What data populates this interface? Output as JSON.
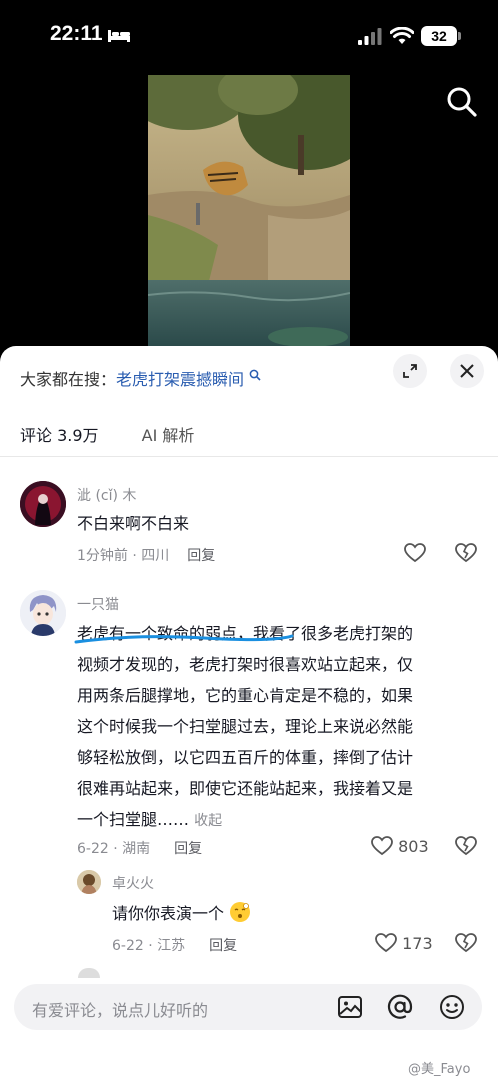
{
  "status_bar": {
    "time": "22:11",
    "battery": "32"
  },
  "hot_search": {
    "prefix": "大家都在搜：",
    "keyword": "老虎打架震撼瞬间"
  },
  "tabs": [
    {
      "label": "评论 3.9万",
      "active": true
    },
    {
      "label": "AI 解析",
      "active": false
    }
  ],
  "comments": [
    {
      "username": "泚 (cǐ) 木",
      "text": "不白来啊不白来",
      "meta": "1分钟前 · 四川",
      "reply": "回复",
      "likes": ""
    },
    {
      "username": "一只猫",
      "text_lines": [
        "老虎有一个致命的弱点，我看了很多老虎打架的",
        "视频才发现的，老虎打架时很喜欢站立起来，仅",
        "用两条后腿撑地，它的重心肯定是不稳的，如果",
        "这个时候我一个扫堂腿过去，理论上来说必然能",
        "够轻松放倒，以它四五百斤的体重，摔倒了估计",
        "很难再站起来，即使它还能站起来，我接着又是"
      ],
      "last_line": "一个扫堂腿……",
      "collapse": "收起",
      "meta": "6-22 · 湖南",
      "reply": "回复",
      "likes": "803"
    },
    {
      "username": "卓火火",
      "text": "请你你表演一个",
      "meta": "6-22 · 江苏",
      "reply": "回复",
      "likes": "173"
    }
  ],
  "input": {
    "placeholder": "有爱评论，说点儿好听的"
  },
  "watermark": "@美_Fayo",
  "colors": {
    "keyword": "#2a5db0",
    "underline": "#1a8fe0",
    "sheet_bg": "#ffffff"
  }
}
